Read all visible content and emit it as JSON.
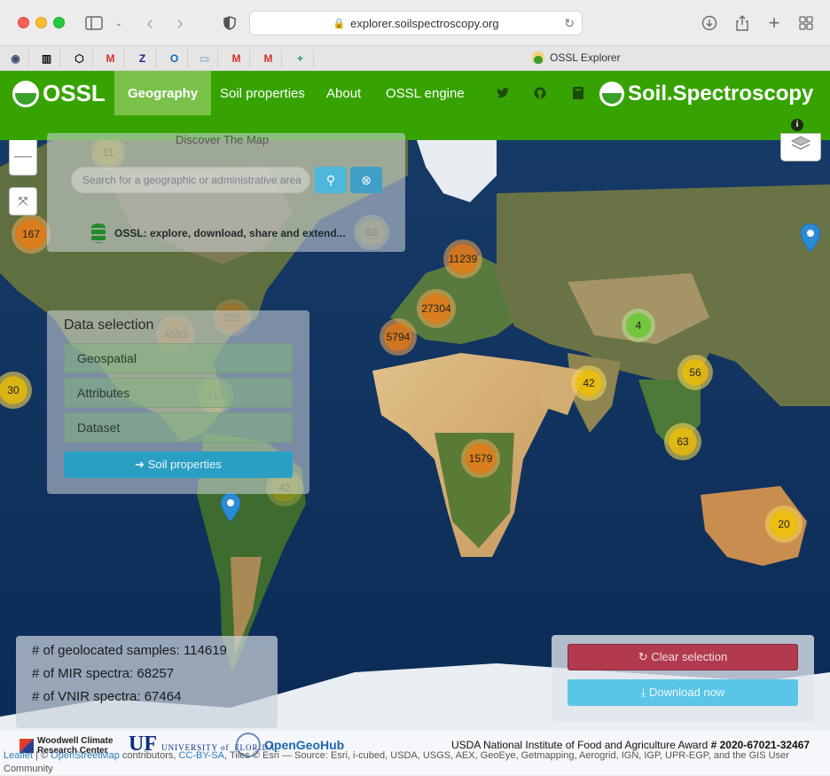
{
  "browser": {
    "url": "explorer.soilspectroscopy.org",
    "tab_title": "OSSL Explorer",
    "favorites": [
      {
        "name": "fav-1",
        "glyph": "◉",
        "color": "#3b4a6b"
      },
      {
        "name": "fav-2",
        "glyph": "▥",
        "color": "#111111"
      },
      {
        "name": "fav-3",
        "glyph": "⬡",
        "color": "#111111"
      },
      {
        "name": "fav-gmail-1",
        "glyph": "M",
        "color": "#d93025"
      },
      {
        "name": "fav-zotero",
        "glyph": "Z",
        "color": "#1a237e"
      },
      {
        "name": "fav-outlook",
        "glyph": "O",
        "color": "#0f6cbd"
      },
      {
        "name": "fav-7",
        "glyph": "▭",
        "color": "#8fb8d6"
      },
      {
        "name": "fav-gmail-2",
        "glyph": "M",
        "color": "#d93025"
      },
      {
        "name": "fav-gmail-3",
        "glyph": "M",
        "color": "#d93025"
      },
      {
        "name": "fav-sheets",
        "glyph": "+",
        "color": "#1a9c4a"
      }
    ]
  },
  "nav": {
    "brand": "OSSL",
    "items": [
      {
        "label": "Geography",
        "active": true
      },
      {
        "label": "Soil properties",
        "active": false
      },
      {
        "label": "About",
        "active": false
      },
      {
        "label": "OSSL engine",
        "active": false
      }
    ],
    "icons": [
      "twitter-icon",
      "github-icon",
      "book-icon"
    ],
    "brand_right": "Soil.Spectroscopy",
    "accent": "#36a303"
  },
  "search": {
    "title": "Discover The Map",
    "placeholder": "Search for a geographic or administrative area",
    "tagline": "OSSL: explore, download, share and extend..."
  },
  "data_selection": {
    "title": "Data selection",
    "buttons": [
      "Geospatial",
      "Attributes",
      "Dataset"
    ],
    "soil_button": "Soil properties"
  },
  "stats": {
    "geolocated": "# of geolocated samples: 114619",
    "mir": "# of MIR spectra: 68257",
    "vnir": "# of VNIR spectra: 67464"
  },
  "actions": {
    "clear": "Clear selection",
    "download": "Download now"
  },
  "clusters": [
    {
      "label": "11",
      "color": "yellow",
      "faint": true
    },
    {
      "label": "167",
      "color": "orange",
      "faint": false
    },
    {
      "label": "83",
      "color": "yellow",
      "faint": true
    },
    {
      "label": "11239",
      "color": "orange",
      "faint": false
    },
    {
      "label": "27304",
      "color": "orange",
      "faint": false
    },
    {
      "label": "5794",
      "color": "orange",
      "faint": false
    },
    {
      "label": "4",
      "color": "green",
      "faint": false
    },
    {
      "label": "56",
      "color": "yellow",
      "faint": false
    },
    {
      "label": "42",
      "color": "yellow",
      "faint": false
    },
    {
      "label": "285",
      "color": "orange",
      "faint": true
    },
    {
      "label": "4593",
      "color": "orange",
      "faint": true
    },
    {
      "label": "414",
      "color": "yellow",
      "faint": true
    },
    {
      "label": "30",
      "color": "yellow",
      "faint": false
    },
    {
      "label": "63",
      "color": "yellow",
      "faint": false
    },
    {
      "label": "1579",
      "color": "orange",
      "faint": false
    },
    {
      "label": "42",
      "color": "yellow",
      "faint": true
    },
    {
      "label": "20",
      "color": "yellow",
      "faint": false
    }
  ],
  "footer": {
    "logo_woodwell_1": "Woodwell Climate",
    "logo_woodwell_2": "Research Center",
    "logo_uf": "UF",
    "logo_uf_sub_1": "UNIVERSITY of",
    "logo_uf_sub_2": "FLORIDA",
    "logo_og": "OpenGeoHub",
    "award_prefix": "USDA National Institute of Food and Agriculture Award ",
    "award_number": "# 2020-67021-32467",
    "attrib_leaflet": "Leaflet",
    "attrib_sep1": " | © ",
    "attrib_osm": "OpenStreetMap",
    "attrib_contrib": " contributors, ",
    "attrib_ccbysa": "CC-BY-SA",
    "attrib_rest": ", Tiles © Esri — Source: Esri, i-cubed, USDA, USGS, AEX, GeoEye, Getmapping, Aerogrid, IGN, IGP, UPR-EGP, and the GIS User Community"
  }
}
